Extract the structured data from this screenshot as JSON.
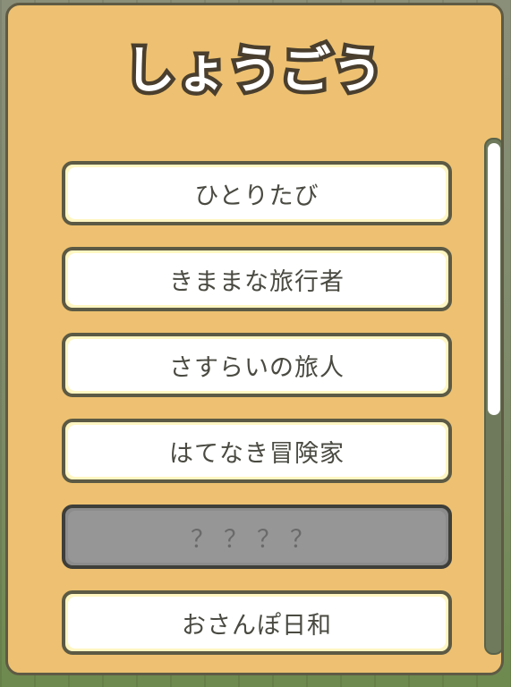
{
  "title": "しょうごう",
  "titles_list": [
    {
      "label": "ひとりたび",
      "locked": false
    },
    {
      "label": "きままな旅行者",
      "locked": false
    },
    {
      "label": "さすらいの旅人",
      "locked": false
    },
    {
      "label": "はてなき冒険家",
      "locked": false
    },
    {
      "label": "？？？？",
      "locked": true
    },
    {
      "label": "おさんぽ日和",
      "locked": false
    }
  ],
  "scroll_position": 0,
  "colors": {
    "panel": "#edc171",
    "panel_border": "#5e5a44",
    "locked": "#969696"
  }
}
